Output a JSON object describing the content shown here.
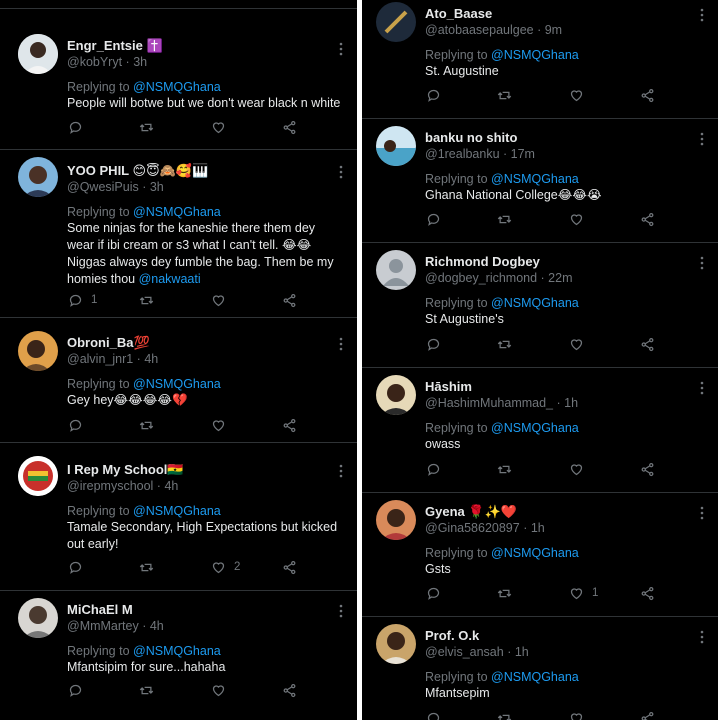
{
  "left_column": {
    "tweets": [
      {
        "name": "Engr_Entsie",
        "name_emoji": "✝️",
        "handle": "@kobYryt",
        "time": "3h",
        "replying_prefix": "Replying to ",
        "replying_to": "@NSMQGhana",
        "text": "People will botwe but we don't wear black n white",
        "reply_count": "",
        "like_count": ""
      },
      {
        "name": "YOO PHIL",
        "name_emoji": "😊😇🙈🥰🎹",
        "handle": "@QwesiPuis",
        "time": "3h",
        "replying_prefix": "Replying to ",
        "replying_to": "@NSMQGhana",
        "text": "Some ninjas for the kaneshie there them dey wear if ibi cream or s3 what I can't tell. 😂😂 Niggas always dey fumble the bag. Them be my homies thou",
        "text_mention": "@nakwaati",
        "reply_count": "1",
        "like_count": ""
      },
      {
        "name": "Obroni_Ba",
        "name_emoji": "💯",
        "handle": "@alvin_jnr1",
        "time": "4h",
        "replying_prefix": "Replying to ",
        "replying_to": "@NSMQGhana",
        "text": "Gey hey😂😂😂😂💔",
        "reply_count": "",
        "like_count": ""
      },
      {
        "name": "I Rep My School",
        "name_emoji": "🇬🇭",
        "handle": "@irepmyschool",
        "time": "4h",
        "replying_prefix": "Replying to ",
        "replying_to": "@NSMQGhana",
        "text": "Tamale Secondary, High Expectations but kicked out early!",
        "reply_count": "",
        "like_count": "2"
      },
      {
        "name": "MiChaEl M",
        "name_emoji": "",
        "handle": "@MmMartey",
        "time": "4h",
        "replying_prefix": "Replying to ",
        "replying_to": "@NSMQGhana",
        "text": "Mfantsipim for sure...hahaha",
        "reply_count": "",
        "like_count": ""
      }
    ]
  },
  "right_column": {
    "tweets": [
      {
        "name": "Ato_Baase",
        "name_emoji": "",
        "handle": "@atobaasepaulgee",
        "time": "9m",
        "replying_prefix": "Replying to ",
        "replying_to": "@NSMQGhana",
        "text": "St. Augustine",
        "reply_count": "",
        "like_count": ""
      },
      {
        "name": "banku no shito",
        "name_emoji": "",
        "handle": "@1realbanku",
        "time": "17m",
        "replying_prefix": "Replying to ",
        "replying_to": "@NSMQGhana",
        "text": "Ghana National College😂😂😭",
        "reply_count": "",
        "like_count": ""
      },
      {
        "name": "Richmond Dogbey",
        "name_emoji": "",
        "handle": "@dogbey_richmond",
        "time": "22m",
        "replying_prefix": "Replying to ",
        "replying_to": "@NSMQGhana",
        "text": "St Augustine's",
        "reply_count": "",
        "like_count": ""
      },
      {
        "name": "Hāshim",
        "name_emoji": "",
        "handle": "@HashimMuhammad_",
        "time": "1h",
        "replying_prefix": "Replying to ",
        "replying_to": "@NSMQGhana",
        "text": "owass",
        "reply_count": "",
        "like_count": ""
      },
      {
        "name": "Gyena",
        "name_emoji": "🌹✨❤️",
        "handle": "@Gina58620897",
        "time": "1h",
        "replying_prefix": "Replying to ",
        "replying_to": "@NSMQGhana",
        "text": "Gsts",
        "reply_count": "",
        "like_count": "1"
      },
      {
        "name": "Prof. O.k",
        "name_emoji": "",
        "handle": "@elvis_ansah",
        "time": "1h",
        "replying_prefix": "Replying to ",
        "replying_to": "@NSMQGhana",
        "text": "Mfantsepim",
        "reply_count": "",
        "like_count": ""
      }
    ]
  },
  "time_separator": " · ",
  "colors": {
    "background": "#000000",
    "text_primary": "#e7e9ea",
    "text_secondary": "#71767b",
    "link": "#1d9bf0",
    "divider": "#2f3336"
  }
}
